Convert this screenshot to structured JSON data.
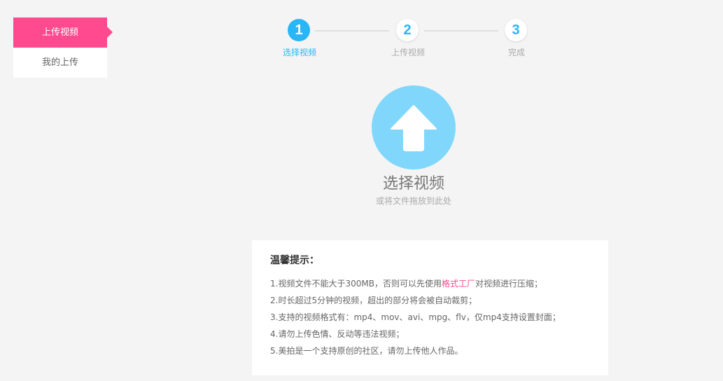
{
  "sidebar": {
    "items": [
      {
        "label": "上传视频",
        "active": true
      },
      {
        "label": "我的上传",
        "active": false
      }
    ]
  },
  "steps": [
    {
      "number": "1",
      "label": "选择视频",
      "active": true
    },
    {
      "number": "2",
      "label": "上传视频",
      "active": false
    },
    {
      "number": "3",
      "label": "完成",
      "active": false
    }
  ],
  "upload": {
    "title": "选择视频",
    "subtitle": "或将文件拖放到此处",
    "icon": "upload-arrow-icon"
  },
  "tips": {
    "title": "温馨提示：",
    "line1_prefix": "1.视频文件不能大于300MB，否则可以先使用",
    "line1_link": "格式工厂",
    "line1_suffix": "对视频进行压缩；",
    "line2": "2.时长超过5分钟的视频，超出的部分将会被自动裁剪；",
    "line3": "3.支持的视频格式有：mp4、mov、avi、mpg、flv，仅mp4支持设置封面；",
    "line4": "4.请勿上传色情、反动等违法视频；",
    "line5": "5.美拍是一个支持原创的社区，请勿上传他人作品。"
  },
  "colors": {
    "accent_pink": "#ff4a8f",
    "accent_blue": "#29b6f6",
    "upload_circle": "#81d7fb",
    "background": "#f4f4f4"
  }
}
